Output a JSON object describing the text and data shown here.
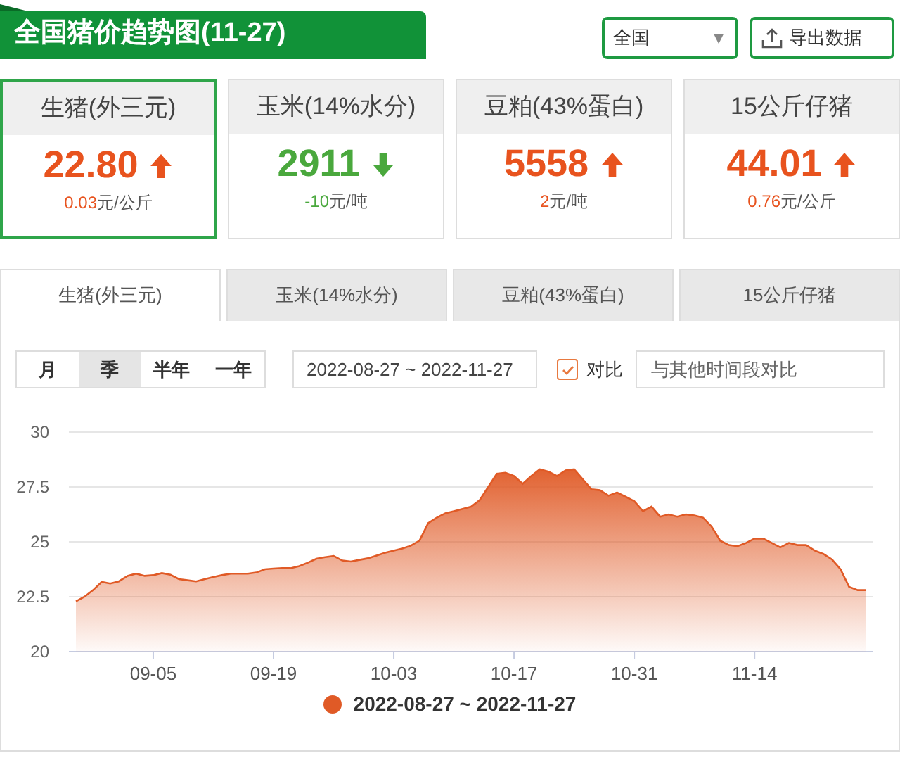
{
  "header": {
    "title": "全国猪价趋势图(11-27)",
    "region_select": "全国",
    "region_caret": "▼",
    "export_button": "导出数据"
  },
  "price_cards": [
    {
      "name": "生猪(外三元)",
      "value": "22.80",
      "kind": "up",
      "change": "0.03",
      "unit": "元/公斤",
      "selected": true
    },
    {
      "name": "玉米(14%水分)",
      "value": "2911",
      "kind": "down",
      "change": "-10",
      "unit": "元/吨",
      "selected": false
    },
    {
      "name": "豆粕(43%蛋白)",
      "value": "5558",
      "kind": "up",
      "change": "2",
      "unit": "元/吨",
      "selected": false
    },
    {
      "name": "15公斤仔猪",
      "value": "44.01",
      "kind": "up",
      "change": "0.76",
      "unit": "元/公斤",
      "selected": false
    }
  ],
  "tabs": [
    {
      "label": "生猪(外三元)",
      "selected": true
    },
    {
      "label": "玉米(14%水分)",
      "selected": false
    },
    {
      "label": "豆粕(43%蛋白)",
      "selected": false
    },
    {
      "label": "15公斤仔猪",
      "selected": false
    }
  ],
  "periods": [
    {
      "label": "月",
      "selected": false
    },
    {
      "label": "季",
      "selected": true
    },
    {
      "label": "半年",
      "selected": false
    },
    {
      "label": "一年",
      "selected": false
    }
  ],
  "date_range": "2022-08-27 ~ 2022-11-27",
  "compare": {
    "label": "对比",
    "checked": true,
    "placeholder": "与其他时间段对比"
  },
  "chart": {
    "chart_data": {
      "type": "area",
      "categories": [
        null,
        null,
        null,
        null,
        null,
        null,
        null,
        null,
        null,
        "09-05",
        null,
        null,
        null,
        null,
        null,
        null,
        null,
        null,
        null,
        null,
        null,
        null,
        null,
        "09-19",
        null,
        null,
        null,
        null,
        null,
        null,
        null,
        null,
        null,
        null,
        null,
        null,
        null,
        "10-03",
        null,
        null,
        null,
        null,
        null,
        null,
        null,
        null,
        null,
        null,
        null,
        null,
        null,
        "10-17",
        null,
        null,
        null,
        null,
        null,
        null,
        null,
        null,
        null,
        null,
        null,
        null,
        null,
        "10-31",
        null,
        null,
        null,
        null,
        null,
        null,
        null,
        null,
        null,
        null,
        null,
        null,
        null,
        "11-14",
        null,
        null,
        null,
        null,
        null,
        null,
        null,
        null,
        null,
        null,
        null,
        null,
        null
      ],
      "series": [
        {
          "name": "2022-08-27 ~ 2022-11-27",
          "color": "#e05a26",
          "values": [
            22.29,
            22.5,
            22.8,
            23.17,
            23.1,
            23.2,
            23.45,
            23.55,
            23.45,
            23.48,
            23.58,
            23.5,
            23.3,
            23.25,
            23.2,
            23.3,
            23.4,
            23.48,
            23.55,
            23.55,
            23.55,
            23.6,
            23.75,
            23.78,
            23.8,
            23.8,
            23.9,
            24.05,
            24.23,
            24.3,
            24.35,
            24.15,
            24.1,
            24.18,
            24.25,
            24.38,
            24.5,
            24.6,
            24.7,
            24.83,
            25.05,
            25.85,
            26.1,
            26.3,
            26.4,
            26.5,
            26.6,
            26.9,
            27.5,
            28.1,
            28.15,
            28.0,
            27.65,
            28.0,
            28.3,
            28.2,
            28.0,
            28.25,
            28.3,
            27.85,
            27.4,
            27.35,
            27.1,
            27.25,
            27.05,
            26.85,
            26.4,
            26.6,
            26.15,
            26.25,
            26.15,
            26.25,
            26.2,
            26.1,
            25.7,
            25.05,
            24.85,
            24.8,
            24.95,
            25.15,
            25.15,
            24.95,
            24.75,
            24.95,
            24.85,
            24.85,
            24.6,
            24.45,
            24.2,
            23.75,
            22.95,
            22.8,
            22.8
          ]
        }
      ],
      "ylim": [
        20,
        30
      ],
      "grid": true,
      "yticks": [
        {
          "value": 20,
          "label": "20"
        },
        {
          "value": 22.5,
          "label": "22.5"
        },
        {
          "value": 25,
          "label": "25"
        },
        {
          "value": 27.5,
          "label": "27.5"
        },
        {
          "value": 30,
          "label": "30"
        }
      ]
    }
  }
}
